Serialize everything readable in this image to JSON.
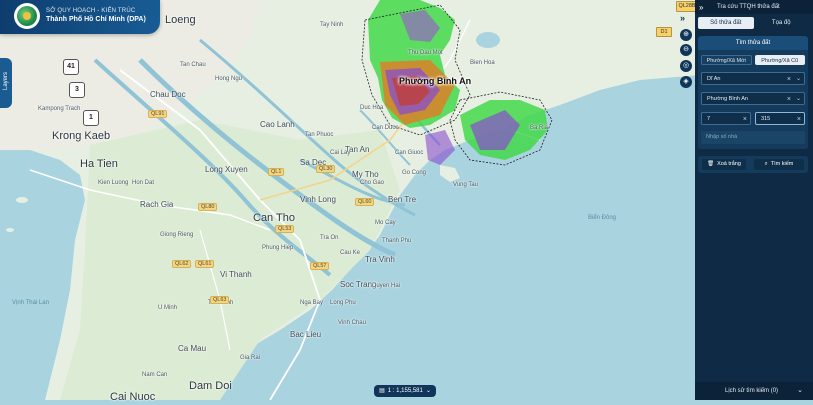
{
  "header": {
    "org_line1": "SỞ QUY HOẠCH - KIẾN TRÚC",
    "org_line2": "Thành Phố Hồ Chí Minh (DPA)"
  },
  "layers_tab": {
    "label": "Layers"
  },
  "map": {
    "highlight_label": "Phường Bình An",
    "scale_text": "1 : 1,155,581",
    "labels_big": [
      "Loeng",
      "Krong Kaeb",
      "Ha Tien",
      "Can Tho",
      "Dam Doi",
      "Cai Nuoc"
    ],
    "labels_med": [
      "Chau Doc",
      "Long Xuyen",
      "Rach Gia",
      "Vi Thanh",
      "Soc Trang",
      "Bac Lieu",
      "Ca Mau",
      "Tan An",
      "My Tho",
      "Ben Tre",
      "Tra Vinh",
      "Vinh Long",
      "Cao Lanh",
      "Sa Dec"
    ],
    "labels_small": [
      "Kampong Trach",
      "Tan Chau",
      "Hong Ngu",
      "Tay Ninh",
      "Thu Dau Mot",
      "Bien Hoa",
      "Ba Ria",
      "Vung Tau",
      "Can Giuoc",
      "Go Cong",
      "Duyen Hai",
      "Nga Bay",
      "Long Phu",
      "Vinh Chau",
      "Gia Rai",
      "Nam Can",
      "U Minh",
      "Thoi Binh",
      "Kien Luong",
      "Hon Dat",
      "Giong Rieng",
      "Phung Hiep",
      "Tra On",
      "Cau Ke",
      "Mo Cay",
      "Thanh Phu",
      "Cho Gao",
      "Cai Lay",
      "Tan Phuoc",
      "Duc Hoa",
      "Can Duoc"
    ],
    "labels_road": [
      "QL1",
      "QL80",
      "QL91",
      "QL61",
      "QL63",
      "QL60",
      "QL53",
      "QL57",
      "QL30",
      "QL62"
    ],
    "labels_sea": [
      "Biển Đông",
      "Vịnh Thái Lan"
    ],
    "shields": [
      "41",
      "3",
      "1"
    ],
    "badge_d01": "D1",
    "badge_ql28b": "QL28B"
  },
  "panel": {
    "title": "Tra cứu TTQH thửa đất",
    "tabs": [
      "Số thửa đất",
      "Tọa độ"
    ],
    "form_header": "Tìm thửa đất",
    "ward_options": [
      "Phường/Xã Mới",
      "Phường/Xã Cũ"
    ],
    "district_value": "Dĩ An",
    "ward_value": "Phường Bình An",
    "sheet_value": "7",
    "parcel_value": "315",
    "address_placeholder": "Nhập số nhà",
    "clear_label": "Xoá trắng",
    "search_label": "Tìm kiếm",
    "history_label": "Lịch sử tìm kiếm (0)"
  },
  "icons": {
    "collapse": "double-chevron-right-icon",
    "zoom_in": "zoom-in-icon",
    "zoom_out": "zoom-out-icon",
    "locate": "locate-icon",
    "layers": "layers-icon"
  },
  "colors": {
    "panel_bg": "#0f2a44",
    "header_bg": "#0d3d6e",
    "land": "#e4eee0",
    "water": "#a9d3df",
    "parcel_green": "#43d84a",
    "parcel_purple": "#8a4ccf",
    "parcel_orange": "#e47b23"
  }
}
